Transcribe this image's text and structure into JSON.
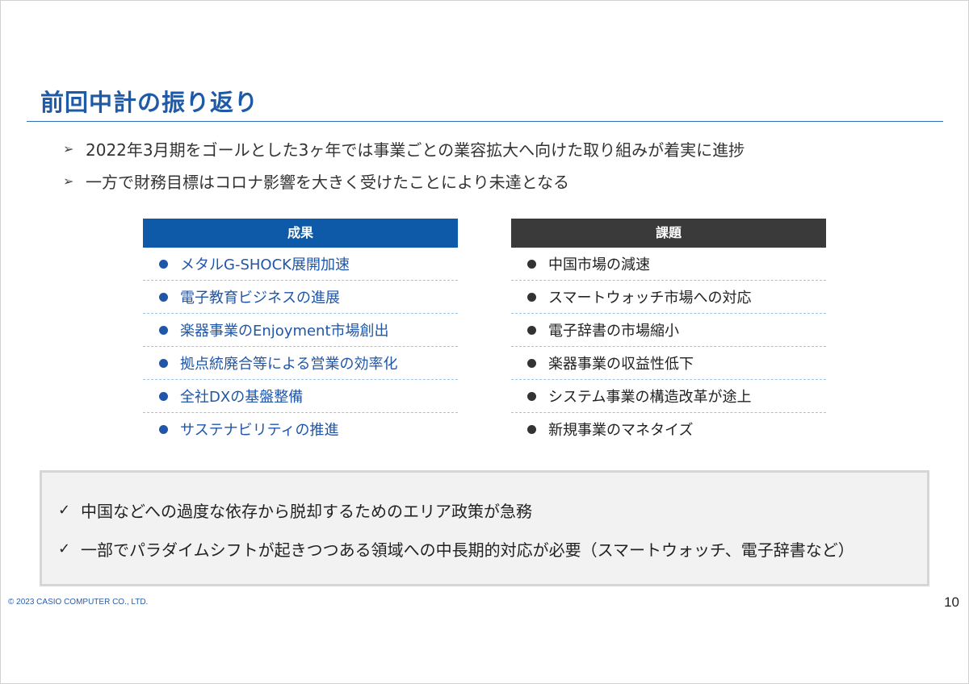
{
  "slide": {
    "title": "前回中計の振り返り",
    "page_number": "10",
    "copyright": "© 2023 CASIO COMPUTER CO., LTD."
  },
  "intro_bullets": [
    "2022年3月期をゴールとした3ヶ年では事業ごとの業容拡大へ向けた取り組みが着実に進捗",
    "一方で財務目標はコロナ影響を大きく受けたことにより未達となる"
  ],
  "results": {
    "header": "成果",
    "items": [
      "メタルG-SHOCK展開加速",
      "電子教育ビジネスの進展",
      "楽器事業のEnjoyment市場創出",
      "拠点統廃合等による営業の効率化",
      "全社DXの基盤整備",
      "サステナビリティの推進"
    ]
  },
  "issues": {
    "header": "課題",
    "items": [
      "中国市場の減速",
      "スマートウォッチ市場への対応",
      "電子辞書の市場縮小",
      "楽器事業の収益性低下",
      "システム事業の構造改革が途上",
      "新規事業のマネタイズ"
    ]
  },
  "summary": [
    "中国などへの過度な依存から脱却するためのエリア政策が急務",
    "一部でパラダイムシフトが起きつつある領域への中長期的対応が必要（スマートウォッチ、電子辞書など）"
  ],
  "colors": {
    "title_blue": "#1f5aa6",
    "results_header": "#0e5aa8",
    "issues_header": "#3a3a3a",
    "summary_bg": "#f2f2f2"
  },
  "icons": {
    "intro_bullet": "arrowhead-bullet-icon",
    "list_bullet": "dot-bullet-icon",
    "summary_bullet": "check-icon"
  }
}
